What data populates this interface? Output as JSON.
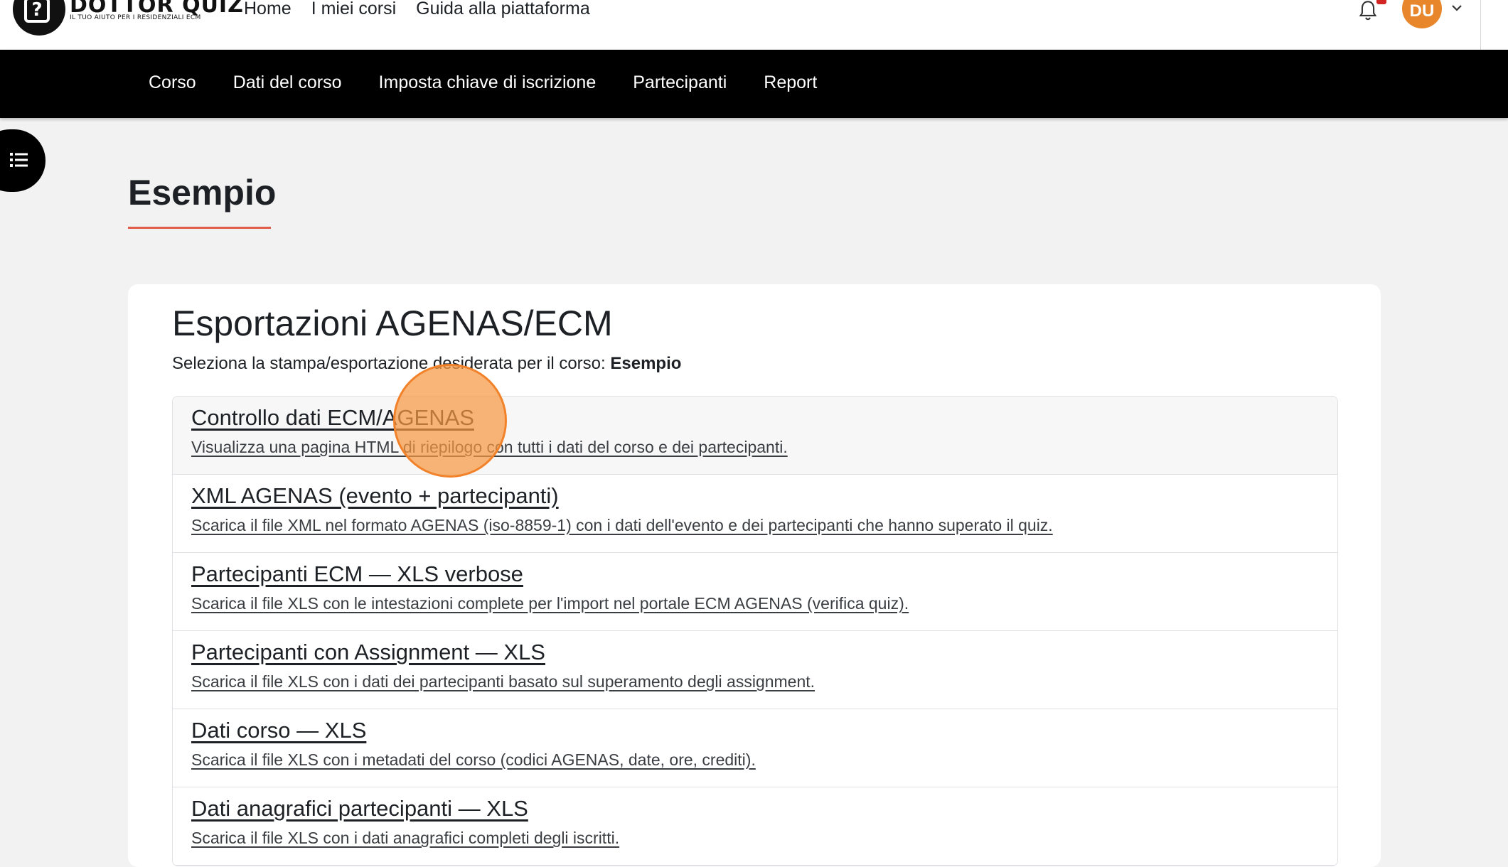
{
  "header": {
    "logo_title": "DOTTOR QUIZ",
    "logo_subtitle": "IL TUO AIUTO PER I RESIDENZIALI ECM",
    "logo_glyph": "?",
    "nav": [
      "Home",
      "I miei corsi",
      "Guida alla piattaforma"
    ],
    "avatar_initials": "DU",
    "notification_icon": "bell-icon",
    "accent_color": "#e8862c"
  },
  "secondary_nav": [
    "Corso",
    "Dati del corso",
    "Imposta chiave di iscrizione",
    "Partecipanti",
    "Report"
  ],
  "page": {
    "title": "Esempio"
  },
  "card": {
    "heading": "Esportazioni AGENAS/ECM",
    "lead_prefix": "Seleziona la stampa/esportazione desiderata per il corso:",
    "lead_course": "Esempio",
    "items": [
      {
        "title": "Controllo dati ECM/AGENAS",
        "description": "Visualizza una pagina HTML di riepilogo con tutti i dati del corso e dei partecipanti."
      },
      {
        "title": "XML AGENAS (evento + partecipanti)",
        "description": "Scarica il file XML nel formato AGENAS (iso-8859-1) con i dati dell'evento e dei partecipanti che hanno superato il quiz."
      },
      {
        "title": "Partecipanti ECM — XLS verbose",
        "description": "Scarica il file XLS con le intestazioni complete per l'import nel portale ECM AGENAS (verifica quiz)."
      },
      {
        "title": "Partecipanti con Assignment — XLS",
        "description": "Scarica il file XLS con i dati dei partecipanti basato sul superamento degli assignment."
      },
      {
        "title": "Dati corso — XLS",
        "description": "Scarica il file XLS con i metadati del corso (codici AGENAS, date, ore, crediti)."
      },
      {
        "title": "Dati anagrafici partecipanti — XLS",
        "description": "Scarica il file XLS con i dati anagrafici completi degli iscritti."
      }
    ]
  }
}
